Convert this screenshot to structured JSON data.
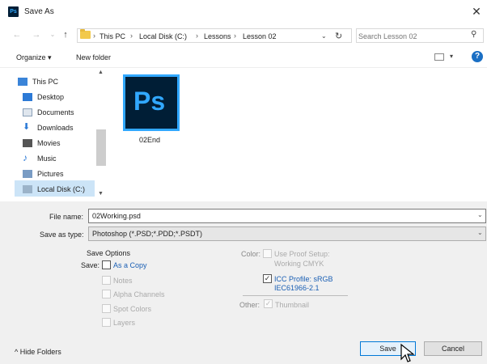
{
  "window": {
    "title": "Save As",
    "app_icon_text": "Ps",
    "close_glyph": "✕"
  },
  "address_bar": {
    "crumbs": [
      "This PC",
      "Local Disk (C:)",
      "Lessons",
      "Lesson 02"
    ],
    "search_placeholder": "Search Lesson 02"
  },
  "command_bar": {
    "organize": "Organize ▾",
    "new_folder": "New folder",
    "help": "?"
  },
  "nav_pane": {
    "items": [
      {
        "label": "This PC",
        "icon": "computer-icon"
      },
      {
        "label": "Desktop",
        "icon": "desktop-icon"
      },
      {
        "label": "Documents",
        "icon": "documents-icon"
      },
      {
        "label": "Downloads",
        "icon": "downloads-icon"
      },
      {
        "label": "Movies",
        "icon": "movies-icon"
      },
      {
        "label": "Music",
        "icon": "music-icon"
      },
      {
        "label": "Pictures",
        "icon": "pictures-icon"
      },
      {
        "label": "Local Disk (C:)",
        "icon": "disk-icon"
      }
    ],
    "selected": "Local Disk (C:)"
  },
  "files": [
    {
      "name": "02End",
      "icon_text": "Ps"
    }
  ],
  "form": {
    "file_name_label": "File name:",
    "file_name_value": "02Working.psd",
    "save_as_type_label": "Save as type:",
    "save_as_type_value": "Photoshop (*.PSD;*.PDD;*.PSDT)"
  },
  "save_options": {
    "heading": "Save Options",
    "save_label": "Save:",
    "as_a_copy": "As a Copy",
    "notes": "Notes",
    "alpha_channels": "Alpha Channels",
    "spot_colors": "Spot Colors",
    "layers": "Layers"
  },
  "color_options": {
    "color_label": "Color:",
    "use_proof_setup": "Use Proof Setup:",
    "working_cmyk": "Working CMYK",
    "icc_profile": "ICC Profile: sRGB",
    "icc_profile_line2": "IEC61966-2.1",
    "other_label": "Other:",
    "thumbnail": "Thumbnail"
  },
  "footer": {
    "hide_folders": "Hide Folders",
    "save": "Save",
    "cancel": "Cancel"
  }
}
